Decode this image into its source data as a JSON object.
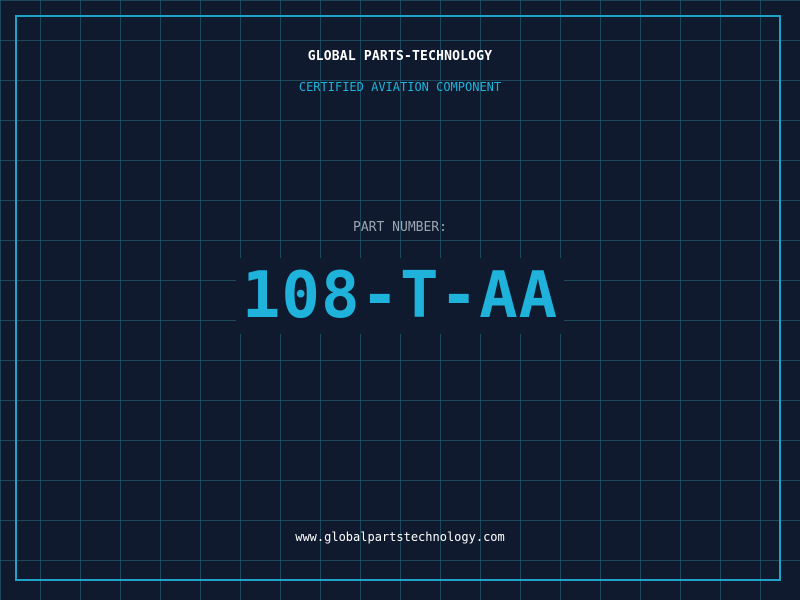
{
  "header": {
    "company_name": "GLOBAL PARTS-TECHNOLOGY",
    "tagline": "CERTIFIED AVIATION COMPONENT"
  },
  "part": {
    "label": "PART NUMBER:",
    "number": "108-T-AA"
  },
  "footer": {
    "website": "www.globalpartstechnology.com"
  },
  "colors": {
    "background": "#0f1a2e",
    "accent": "#1fb2db",
    "grid": "#286e82",
    "label": "#9aa6b2",
    "text": "#ffffff"
  }
}
